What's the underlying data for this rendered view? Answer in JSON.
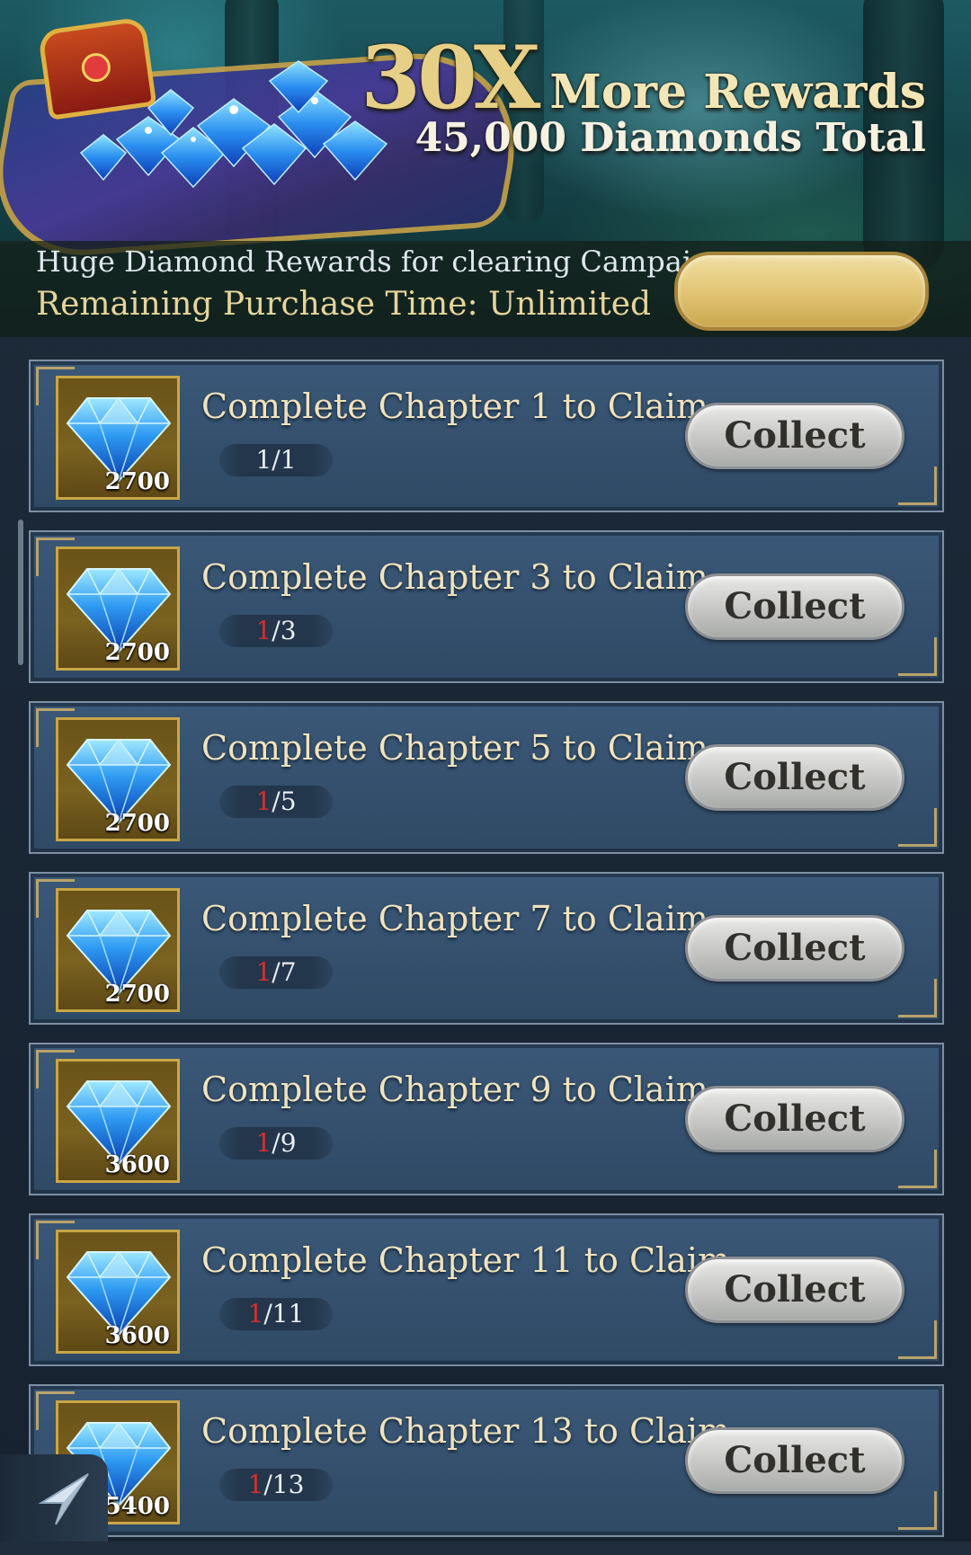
{
  "banner": {
    "multiplier": "30X",
    "headline": "More Rewards",
    "subheadline": "45,000 Diamonds Total",
    "description": "Huge Diamond Rewards for clearing Campaign",
    "purchase_time": "Remaining Purchase Time: Unlimited",
    "purchase_button_label": ""
  },
  "colors": {
    "gold_accent": "#c8a646",
    "progress_incomplete": "#d23030",
    "row_bg": "#3b5878",
    "button_silver": "#c9cac8"
  },
  "icons": {
    "reward": "blue-diamond-icon",
    "chest": "treasure-chest-icon",
    "back": "back-arrow-icon"
  },
  "rows": [
    {
      "title": "Complete Chapter 1 to Claim",
      "amount": "2700",
      "progress_current": "1",
      "progress_total": "/1",
      "button": "Collect"
    },
    {
      "title": "Complete Chapter 3 to Claim",
      "amount": "2700",
      "progress_current": "1",
      "progress_total": "/3",
      "button": "Collect"
    },
    {
      "title": "Complete Chapter 5 to Claim",
      "amount": "2700",
      "progress_current": "1",
      "progress_total": "/5",
      "button": "Collect"
    },
    {
      "title": "Complete Chapter 7 to Claim",
      "amount": "2700",
      "progress_current": "1",
      "progress_total": "/7",
      "button": "Collect"
    },
    {
      "title": "Complete Chapter 9 to Claim",
      "amount": "3600",
      "progress_current": "1",
      "progress_total": "/9",
      "button": "Collect"
    },
    {
      "title": "Complete Chapter 11 to Claim",
      "amount": "3600",
      "progress_current": "1",
      "progress_total": "/11",
      "button": "Collect"
    },
    {
      "title": "Complete Chapter 13 to Claim",
      "amount": "5400",
      "progress_current": "1",
      "progress_total": "/13",
      "button": "Collect"
    }
  ]
}
